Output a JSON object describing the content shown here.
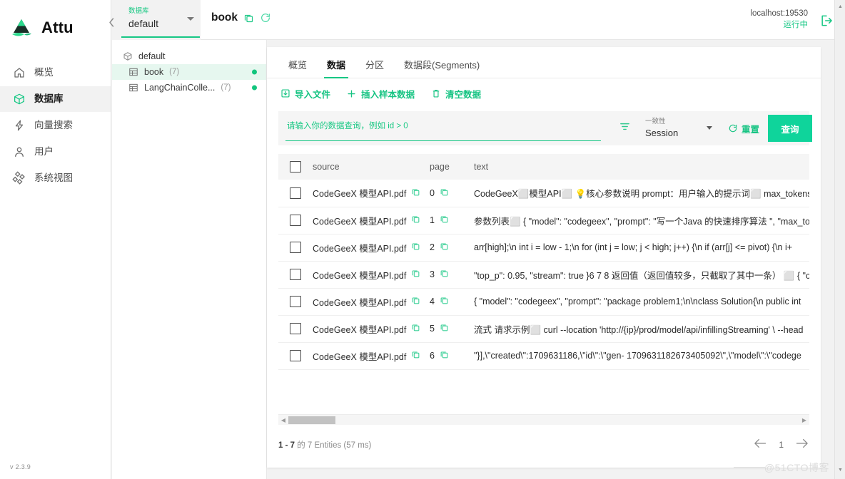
{
  "app": {
    "brand": "Attu",
    "version": "v 2.3.9",
    "logo_icon": "attu-logo-icon"
  },
  "sidebar": {
    "items": [
      {
        "label": "概览",
        "icon": "home-icon",
        "active": false
      },
      {
        "label": "数据库",
        "icon": "cube-icon",
        "active": true
      },
      {
        "label": "向量搜索",
        "icon": "lightning-icon",
        "active": false
      },
      {
        "label": "用户",
        "icon": "user-icon",
        "active": false
      },
      {
        "label": "系统视图",
        "icon": "system-view-icon",
        "active": false
      }
    ]
  },
  "db_selector": {
    "label": "数据库",
    "value": "default",
    "caret_icon": "chevron-down-icon"
  },
  "tree": {
    "root": {
      "label": "default",
      "icon": "database-icon"
    },
    "collections": [
      {
        "label": "book",
        "count": "(7)",
        "icon": "table-icon",
        "selected": true,
        "status": "loaded"
      },
      {
        "label": "LangChainColle...",
        "count": "(7)",
        "icon": "table-icon",
        "selected": false,
        "status": "loaded"
      }
    ]
  },
  "topbar": {
    "collection_name": "book",
    "copy_icon": "copy-icon",
    "refresh_icon": "refresh-icon",
    "host": "localhost:19530",
    "status": "运行中",
    "logout_icon": "logout-icon"
  },
  "tabs": [
    {
      "label": "概览",
      "active": false
    },
    {
      "label": "数据",
      "active": true
    },
    {
      "label": "分区",
      "active": false
    },
    {
      "label": "数据段(Segments)",
      "active": false
    }
  ],
  "actions": [
    {
      "label": "导入文件",
      "icon": "import-file-icon"
    },
    {
      "label": "插入样本数据",
      "icon": "plus-icon"
    },
    {
      "label": "清空数据",
      "icon": "trash-icon"
    }
  ],
  "query_bar": {
    "placeholder": "请输入你的数据查询，例如 id > 0",
    "value": "",
    "filter_icon": "filter-icon",
    "consistency_label": "一致性",
    "consistency_value": "Session",
    "reset_label": "重置",
    "reset_icon": "refresh-icon",
    "query_label": "查询"
  },
  "table": {
    "columns": [
      "",
      "source",
      "page",
      "text"
    ],
    "rows": [
      {
        "source": "CodeGeeX 模型API.pdf",
        "page": "0",
        "text": "CodeGeeX⬜模型API⬜ 💡核心参数说明 prompt：用户输入的提示词⬜ max_tokens：模"
      },
      {
        "source": "CodeGeeX 模型API.pdf",
        "page": "1",
        "text": "参数列表⬜ { \"model\": \"codegeex\", \"prompt\": \"写一个Java 的快速排序算法 \", \"max_tok"
      },
      {
        "source": "CodeGeeX 模型API.pdf",
        "page": "2",
        "text": "arr[high];\\n int i = low - 1;\\n for (int j = low; j < high; j++) {\\n if (arr[j] <= pivot) {\\n i+"
      },
      {
        "source": "CodeGeeX 模型API.pdf",
        "page": "3",
        "text": "\"top_p\": 0.95, \"stream\": true }6 7 8 返回值（返回值较多，只截取了其中一条） ⬜ { \"co"
      },
      {
        "source": "CodeGeeX 模型API.pdf",
        "page": "4",
        "text": "{ \"model\": \"codegeex\", \"prompt\": \"package problem1;\\n\\nclass Solution{\\n public int"
      },
      {
        "source": "CodeGeeX 模型API.pdf",
        "page": "5",
        "text": "流式 请求示例⬜ curl --location 'http://{ip}/prod/model/api/infillingStreaming' \\ --head"
      },
      {
        "source": "CodeGeeX 模型API.pdf",
        "page": "6",
        "text": "\"}],\\\"created\\\":1709631186,\\\"id\\\":\\\"gen- 1709631182673405092\\\",\\\"model\\\":\\\"codege"
      }
    ]
  },
  "footer": {
    "range": "1 - 7",
    "suffix": "的 7 Entities (57 ms)",
    "page_number": "1",
    "prev_icon": "arrow-left-icon",
    "next_icon": "arrow-right-icon"
  },
  "watermark": "@51CTO博客",
  "colors": {
    "accent": "#16c784",
    "accent_button": "#0fd49b",
    "status_dot": "#12c57d",
    "selected_row": "#e6f7ef",
    "page_bg": "#f2f2f2"
  }
}
